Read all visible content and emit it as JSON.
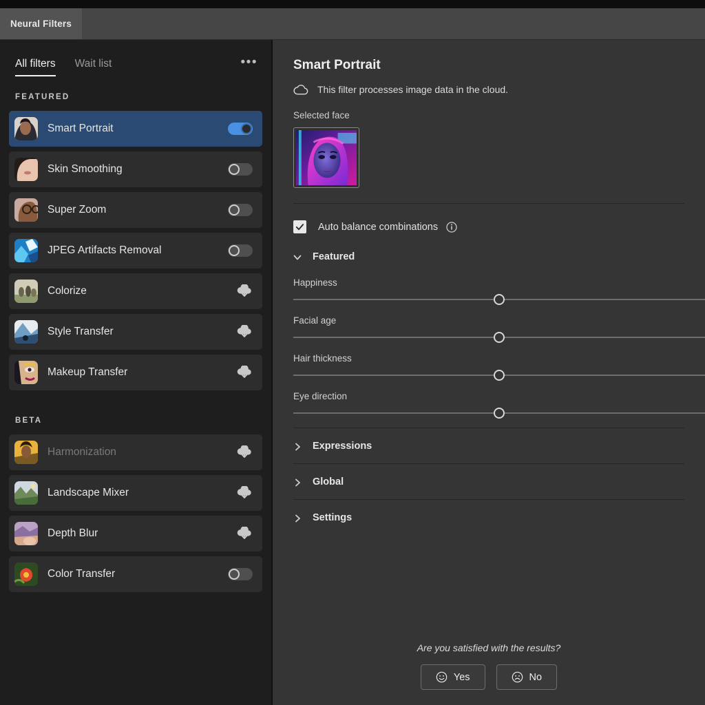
{
  "window": {
    "tab_label": "Neural Filters"
  },
  "sidebar": {
    "tabs": [
      {
        "label": "All filters",
        "active": true
      },
      {
        "label": "Wait list",
        "active": false
      }
    ],
    "overflow_menu": "•••",
    "groups": [
      {
        "title": "FEATURED",
        "items": [
          {
            "label": "Smart Portrait",
            "control": "toggle-on",
            "selected": true,
            "disabled": false
          },
          {
            "label": "Skin Smoothing",
            "control": "toggle-off",
            "selected": false,
            "disabled": false
          },
          {
            "label": "Super Zoom",
            "control": "toggle-off",
            "selected": false,
            "disabled": false
          },
          {
            "label": "JPEG Artifacts Removal",
            "control": "toggle-off",
            "selected": false,
            "disabled": false
          },
          {
            "label": "Colorize",
            "control": "cloud-download",
            "selected": false,
            "disabled": false
          },
          {
            "label": "Style Transfer",
            "control": "cloud-download",
            "selected": false,
            "disabled": false
          },
          {
            "label": "Makeup Transfer",
            "control": "cloud-download",
            "selected": false,
            "disabled": false
          }
        ]
      },
      {
        "title": "BETA",
        "items": [
          {
            "label": "Harmonization",
            "control": "cloud-download",
            "selected": false,
            "disabled": true
          },
          {
            "label": "Landscape Mixer",
            "control": "cloud-download",
            "selected": false,
            "disabled": false
          },
          {
            "label": "Depth Blur",
            "control": "cloud-download",
            "selected": false,
            "disabled": false
          },
          {
            "label": "Color Transfer",
            "control": "toggle-off",
            "selected": false,
            "disabled": false
          }
        ]
      }
    ]
  },
  "detail": {
    "title": "Smart Portrait",
    "cloud_notice": "This filter processes image data in the cloud.",
    "selected_face_label": "Selected face",
    "auto_balance": {
      "label": "Auto balance combinations",
      "checked": true
    },
    "featured_section": {
      "label": "Featured",
      "expanded": true,
      "sliders": [
        {
          "label": "Happiness",
          "value": 0,
          "percent": 50
        },
        {
          "label": "Facial age",
          "value": 0,
          "percent": 50
        },
        {
          "label": "Hair thickness",
          "value": 0,
          "percent": 50
        },
        {
          "label": "Eye direction",
          "value": 0,
          "percent": 50
        }
      ]
    },
    "collapsed_sections": [
      {
        "label": "Expressions"
      },
      {
        "label": "Global"
      },
      {
        "label": "Settings"
      }
    ],
    "feedback": {
      "question": "Are you satisfied with the results?",
      "yes_label": "Yes",
      "no_label": "No"
    }
  },
  "colors": {
    "accent_blue": "#4a90e2",
    "selected_row": "#2a4a73",
    "panel_bg": "#353535",
    "sidebar_bg": "#1e1e1e"
  }
}
